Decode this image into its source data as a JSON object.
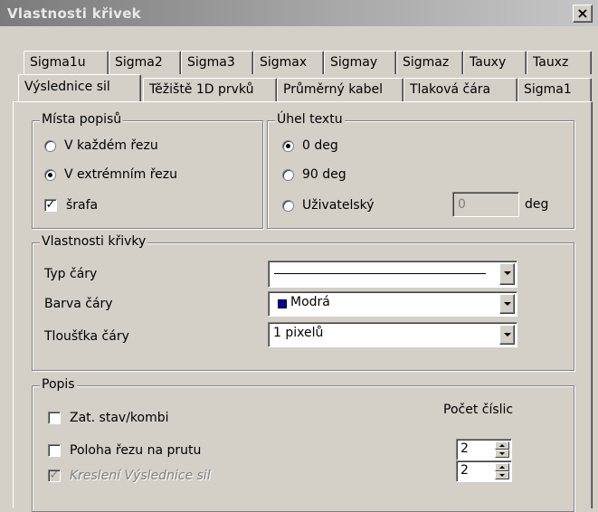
{
  "window": {
    "title": "Vlastnosti křivek",
    "close_glyph": "×"
  },
  "tabs_row1": [
    "Sigma1u",
    "Sigma2",
    "Sigma3",
    "Sigmax",
    "Sigmay",
    "Sigmaz",
    "Tauxy",
    "Tauxz"
  ],
  "tabs_row2": [
    "Výslednice sil",
    "Těžiště 1D prvků",
    "Průměrný kabel",
    "Tlaková čára",
    "Sigma1"
  ],
  "active_tab": "Výslednice sil",
  "mista_popisu": {
    "legend": "Místa popisů",
    "option1": "V každém řezu",
    "option1_selected": false,
    "option2": "V extrémním řezu",
    "option2_selected": true,
    "hatch_label": "šrafa",
    "hatch_checked": true,
    "check_glyph": "✓"
  },
  "uhel_textu": {
    "legend": "Úhel textu",
    "option1": "0 deg",
    "option1_selected": true,
    "option2": "90 deg",
    "option2_selected": false,
    "option3": "Uživatelský",
    "option3_selected": false,
    "custom_value": "0",
    "unit": "deg"
  },
  "vlastnosti_krivky": {
    "legend": "Vlastnosti křivky",
    "line_type_label": "Typ čáry",
    "line_color_label": "Barva čáry",
    "line_color_value": "Modrá",
    "line_color_hex": "#0000a8",
    "line_width_label": "Tloušťka čáry",
    "line_width_value": "1 pixelů"
  },
  "popis": {
    "legend": "Popis",
    "digits_label": "Počet číslic",
    "check1_label": "Zat. stav/kombi",
    "check1_checked": false,
    "check2_label": "Poloha řezu na prutu",
    "check2_checked": false,
    "check3_label": "Kreslení Výslednice sil",
    "check3_checked": true,
    "spin1_value": "2",
    "spin2_value": "2"
  }
}
